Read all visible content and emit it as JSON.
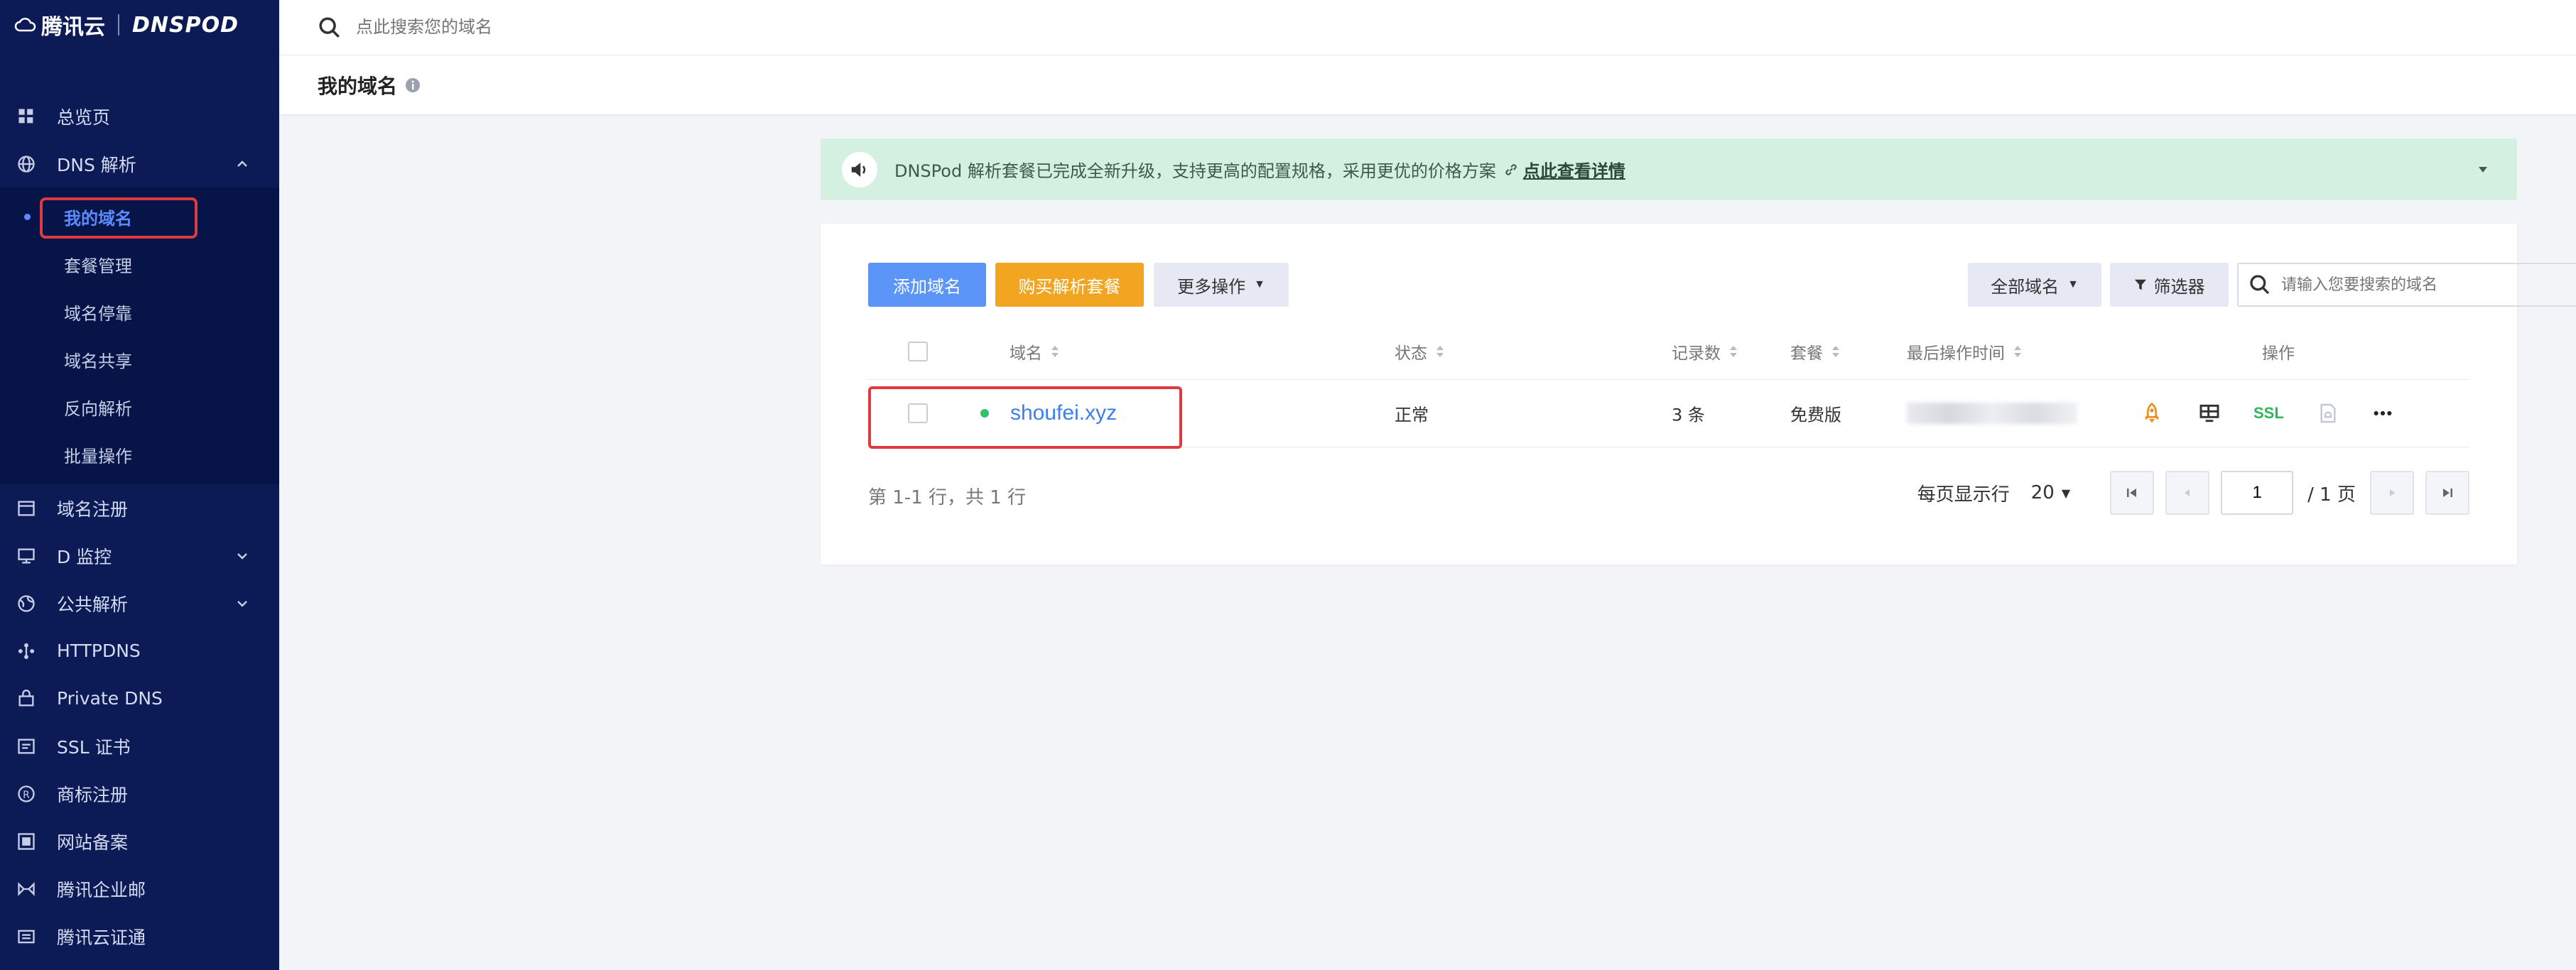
{
  "brand": {
    "cloud_name": "腾讯云",
    "product": "DNSPOD"
  },
  "sidebar": {
    "items": [
      {
        "label": "总览页",
        "icon": "grid-icon"
      },
      {
        "label": "DNS 解析",
        "icon": "globe-icon",
        "expanded": true
      },
      {
        "label": "域名注册",
        "icon": "window-icon"
      },
      {
        "label": "D 监控",
        "icon": "monitor-icon"
      },
      {
        "label": "公共解析",
        "icon": "public-globe-icon"
      },
      {
        "label": "HTTPDNS",
        "icon": "network-icon"
      },
      {
        "label": "Private DNS",
        "icon": "lock-box-icon"
      },
      {
        "label": "SSL 证书",
        "icon": "certificate-icon"
      },
      {
        "label": "商标注册",
        "icon": "registered-icon"
      },
      {
        "label": "网站备案",
        "icon": "record-icon"
      },
      {
        "label": "腾讯企业邮",
        "icon": "mail-icon"
      },
      {
        "label": "腾讯云证通",
        "icon": "id-card-icon"
      }
    ],
    "dns_submenu": [
      "我的域名",
      "套餐管理",
      "域名停靠",
      "域名共享",
      "反向解析",
      "批量操作"
    ],
    "active_sub": "我的域名"
  },
  "topbar": {
    "search_placeholder": "点此搜索您的域名"
  },
  "page": {
    "title": "我的域名"
  },
  "banner": {
    "text": "DNSPod 解析套餐已完成全新升级，支持更高的配置规格，采用更优的价格方案",
    "link": "点此查看详情"
  },
  "toolbar": {
    "add_label": "添加域名",
    "buy_label": "购买解析套餐",
    "more_label": "更多操作",
    "all_domains_label": "全部域名",
    "filter_label": "筛选器",
    "search_placeholder": "请输入您要搜索的域名"
  },
  "table": {
    "headers": {
      "domain": "域名",
      "status": "状态",
      "records": "记录数",
      "plan": "套餐",
      "last_op": "最后操作时间",
      "actions": "操作"
    },
    "rows": [
      {
        "domain": "shoufei.xyz",
        "status": "正常",
        "records": "3 条",
        "plan": "免费版",
        "ssl": "SSL"
      }
    ]
  },
  "footer": {
    "count_text": "第 1-1 行，共 1 行",
    "per_page_label": "每页显示行",
    "per_page": "20",
    "current_page": "1",
    "total_pages": "/ 1 页"
  },
  "colors": {
    "sidebar_bg": "#0c1b55",
    "accent_blue": "#5b95f7",
    "accent_orange": "#f2a521",
    "banner_bg": "#d3f0e0",
    "highlight_red": "#e0393e"
  }
}
